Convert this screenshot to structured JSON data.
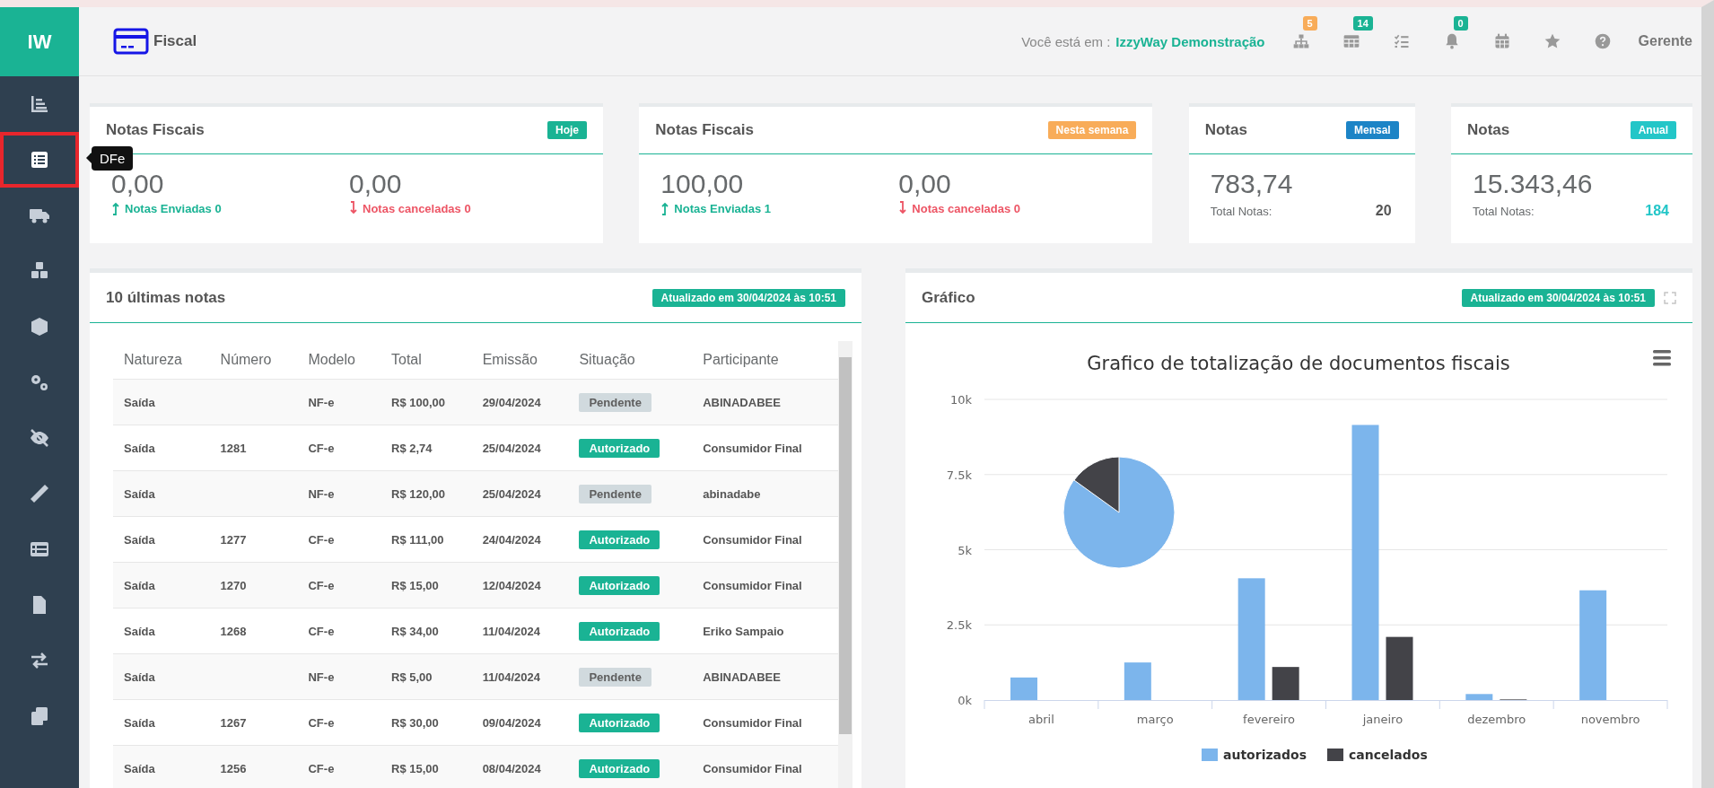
{
  "sidebar": {
    "logo": "IW",
    "tooltip": "DFe",
    "items": [
      {
        "kind": "chart",
        "selected": false
      },
      {
        "kind": "list",
        "selected": true
      },
      {
        "kind": "truck",
        "selected": false
      },
      {
        "kind": "cubes",
        "selected": false
      },
      {
        "kind": "cube",
        "selected": false
      },
      {
        "kind": "cogs",
        "selected": false
      },
      {
        "kind": "eye-slash",
        "selected": false
      },
      {
        "kind": "ruler",
        "selected": false
      },
      {
        "kind": "table",
        "selected": false
      },
      {
        "kind": "file",
        "selected": false
      },
      {
        "kind": "exchange",
        "selected": false
      },
      {
        "kind": "copy",
        "selected": false
      }
    ]
  },
  "header": {
    "title": "Fiscal",
    "location_label": "Você está em :",
    "location": "IzzyWay Demonstração",
    "user": "Gerente",
    "icons": [
      {
        "kind": "sitemap",
        "badge": "5",
        "color": "#f8ac59"
      },
      {
        "kind": "table",
        "badge": "14",
        "color": "#1ab394"
      },
      {
        "kind": "tasks"
      },
      {
        "kind": "bell",
        "badge": "0",
        "color": "#1ab394"
      },
      {
        "kind": "calendar"
      },
      {
        "kind": "star"
      },
      {
        "kind": "help"
      }
    ]
  },
  "summary_cards": [
    {
      "kind": "split",
      "title": "Notas Fiscais",
      "tag": "Hoje",
      "color": "#1ab394",
      "values": [
        {
          "value": "0,00",
          "label": "Notas Enviadas 0",
          "kind": "up"
        },
        {
          "value": "0,00",
          "label": "Notas canceladas 0",
          "kind": "down"
        }
      ]
    },
    {
      "kind": "split",
      "title": "Notas Fiscais",
      "tag": "Nesta semana",
      "color": "#f8ac59",
      "values": [
        {
          "value": "100,00",
          "label": "Notas Enviadas 1",
          "kind": "up"
        },
        {
          "value": "0,00",
          "label": "Notas canceladas 0",
          "kind": "down"
        }
      ]
    },
    {
      "kind": "total",
      "title": "Notas",
      "tag": "Mensal",
      "color": "#1c84c6",
      "value": "783,74",
      "total_label": "Total Notas:",
      "total": "20",
      "total_highlight": false
    },
    {
      "kind": "total",
      "title": "Notas",
      "tag": "Anual",
      "color": "#23c6c8",
      "value": "15.343,46",
      "total_label": "Total Notas:",
      "total": "184",
      "total_highlight": true
    }
  ],
  "latest": {
    "title": "10 últimas notas",
    "updated": "Atualizado em 30/04/2024 às 10:51",
    "columns": [
      "Natureza",
      "Número",
      "Modelo",
      "Total",
      "Emissão",
      "Situação",
      "Participante"
    ],
    "rows": [
      {
        "natureza": "Saída",
        "modelo": "NF-e",
        "total": "R$ 100,00",
        "emissao": "29/04/2024",
        "situacao": "Pendente",
        "color": "#d1dade",
        "participante": "ABINADABEE"
      },
      {
        "natureza": "Saída",
        "numero": "1281",
        "modelo": "CF-e",
        "total": "R$ 2,74",
        "emissao": "25/04/2024",
        "situacao": "Autorizado",
        "color": "#1ab394",
        "participante": "Consumidor Final"
      },
      {
        "natureza": "Saída",
        "modelo": "NF-e",
        "total": "R$ 120,00",
        "emissao": "25/04/2024",
        "situacao": "Pendente",
        "color": "#d1dade",
        "participante": "abinadabe"
      },
      {
        "natureza": "Saída",
        "numero": "1277",
        "modelo": "CF-e",
        "total": "R$ 111,00",
        "emissao": "24/04/2024",
        "situacao": "Autorizado",
        "color": "#1ab394",
        "participante": "Consumidor Final"
      },
      {
        "natureza": "Saída",
        "numero": "1270",
        "modelo": "CF-e",
        "total": "R$ 15,00",
        "emissao": "12/04/2024",
        "situacao": "Autorizado",
        "color": "#1ab394",
        "participante": "Consumidor Final"
      },
      {
        "natureza": "Saída",
        "numero": "1268",
        "modelo": "CF-e",
        "total": "R$ 34,00",
        "emissao": "11/04/2024",
        "situacao": "Autorizado",
        "color": "#1ab394",
        "participante": "Eriko Sampaio"
      },
      {
        "natureza": "Saída",
        "modelo": "NF-e",
        "total": "R$ 5,00",
        "emissao": "11/04/2024",
        "situacao": "Pendente",
        "color": "#d1dade",
        "participante": "ABINADABEE"
      },
      {
        "natureza": "Saída",
        "numero": "1267",
        "modelo": "CF-e",
        "total": "R$ 30,00",
        "emissao": "09/04/2024",
        "situacao": "Autorizado",
        "color": "#1ab394",
        "participante": "Consumidor Final"
      },
      {
        "natureza": "Saída",
        "numero": "1256",
        "modelo": "CF-e",
        "total": "R$ 15,00",
        "emissao": "08/04/2024",
        "situacao": "Autorizado",
        "color": "#1ab394",
        "participante": "Consumidor Final"
      }
    ]
  },
  "chart_panel": {
    "title": "Gráfico",
    "updated": "Atualizado em 30/04/2024 às 10:51",
    "chart_data": {
      "type": "bar",
      "title": "Grafico de totalização de documentos fiscais",
      "categories": [
        "abril",
        "março",
        "fevereiro",
        "janeiro",
        "dezembro",
        "novembro"
      ],
      "ylim": [
        0,
        10000
      ],
      "grid": true,
      "legend": true,
      "yticks": [
        {
          "value": 0,
          "label": "0k"
        },
        {
          "value": 2500,
          "label": "2.5k"
        },
        {
          "value": 5000,
          "label": "5k"
        },
        {
          "value": 7500,
          "label": "7.5k"
        },
        {
          "value": 10000,
          "label": "10k"
        }
      ],
      "series": [
        {
          "name": "autorizados",
          "color": "#7cb5ec",
          "values": [
            750,
            1250,
            4050,
            9150,
            200,
            3650
          ]
        },
        {
          "name": "cancelados",
          "color": "#434348",
          "values": [
            0,
            0,
            1100,
            2100,
            20,
            0
          ]
        }
      ]
    }
  }
}
